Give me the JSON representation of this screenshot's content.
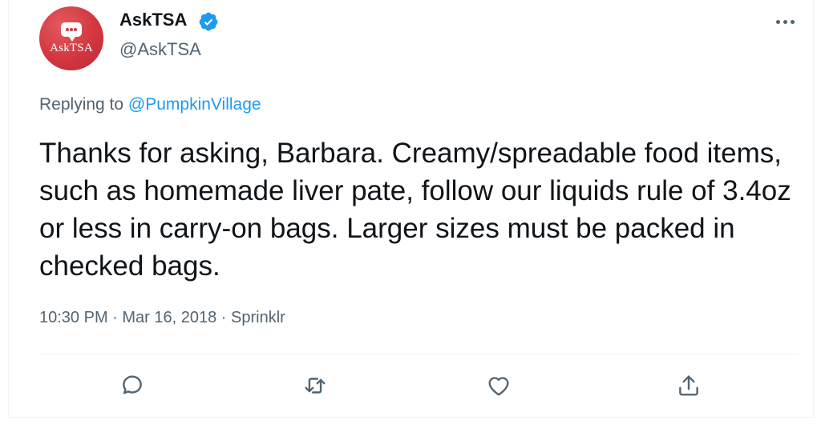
{
  "author": {
    "avatar_text": "AskTSA",
    "display_name": "AskTSA",
    "handle": "@AskTSA",
    "verified": true
  },
  "reply_context": {
    "prefix": "Replying to ",
    "mention": "@PumpkinVillage"
  },
  "tweet": {
    "text": "Thanks for asking, Barbara. Creamy/spreadable food items, such as homemade liver pate, follow our liquids rule of 3.4oz or less in carry-on bags. Larger sizes must be packed in checked bags."
  },
  "meta": {
    "time": "10:30 PM",
    "date": "Mar 16, 2018",
    "source": "Sprinklr",
    "separator": " · "
  },
  "icons": {
    "more": "more-horizontal-icon",
    "verified": "verified-badge-icon",
    "reply": "reply-icon",
    "retweet": "retweet-icon",
    "like": "heart-icon",
    "share": "share-icon"
  },
  "colors": {
    "brand_avatar": "#d3363f",
    "link": "#1d9bf0",
    "verified": "#1d9bf0",
    "text_primary": "#0f1419",
    "text_secondary": "#536471",
    "divider": "#eff3f4"
  }
}
